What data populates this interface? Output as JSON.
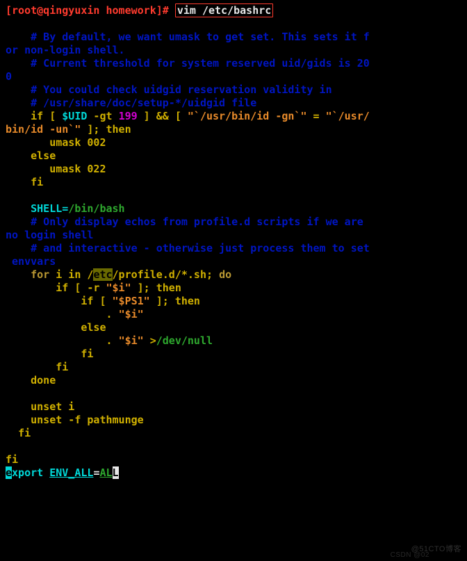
{
  "prompt": {
    "bracket1": "[",
    "user_host": "root@qingyuxin ",
    "dir": "homework",
    "bracket2": "]# ",
    "cmd": "vim /etc/bashrc"
  },
  "c": {
    "c1a": "    # By default, we want umask to get set. This sets it f",
    "c1b": "or non-login shell.",
    "c2a": "    # Current threshold for system reserved uid/gids is 20",
    "c2b": "0",
    "c3": "    # You could check uidgid reservation validity in",
    "c4": "    # /usr/share/doc/setup-*/uidgid file",
    "cond": {
      "p1": "    if [ ",
      "uid": "$UID",
      "p2": " -gt ",
      "num": "199",
      "p3": " ] && [ ",
      "s1": "\"`/usr/bin/id -gn`\"",
      "p4": " = ",
      "s2": "\"`/usr/",
      "s2b": "bin/id -un`\"",
      "p5": " ]; then"
    },
    "u002": "       umask 002",
    "else_": "    else",
    "u022": "       umask 022",
    "fi1": "    fi",
    "shell": {
      "lhs": "    SHELL=",
      "rhs": "/bin/bash"
    },
    "c5a": "    # Only display echos from profile.d scripts if we are ",
    "c5b": "no login shell",
    "c6a": "    # and interactive - otherwise just process them to set",
    "c6b": " envvars",
    "for": {
      "p1": "    for",
      "p2": " i in /",
      "etc": "etc",
      "p3": "/profile.d/*.sh; ",
      "p4": "do"
    },
    "if_r": {
      "p1": "        if [ -r ",
      "s": "\"$i\"",
      "p2": " ]; then"
    },
    "if_ps1": {
      "p1": "            if [ ",
      "s": "\"$PS1\"",
      "p2": " ]; then"
    },
    "dot1": {
      "p1": "                . ",
      "s": "\"$i\""
    },
    "else2": "            else",
    "dot2": {
      "p1": "                . ",
      "s": "\"$i\"",
      "p2": " >",
      "dev": "/dev/null"
    },
    "fi2": "            fi",
    "fi3": "        fi",
    "done": "    done",
    "unset1": "    unset i",
    "unset2": "    unset -f pathmunge",
    "fi4": "  fi",
    "fi5": "fi",
    "export": {
      "e": "e",
      "rest": "xport",
      "sp": " ",
      "var": "ENV_ALL",
      "eq": "=",
      "val": "AL",
      "val_last": "L"
    }
  },
  "wm1": "@51CTO博客",
  "wm2": "CSDN @02"
}
